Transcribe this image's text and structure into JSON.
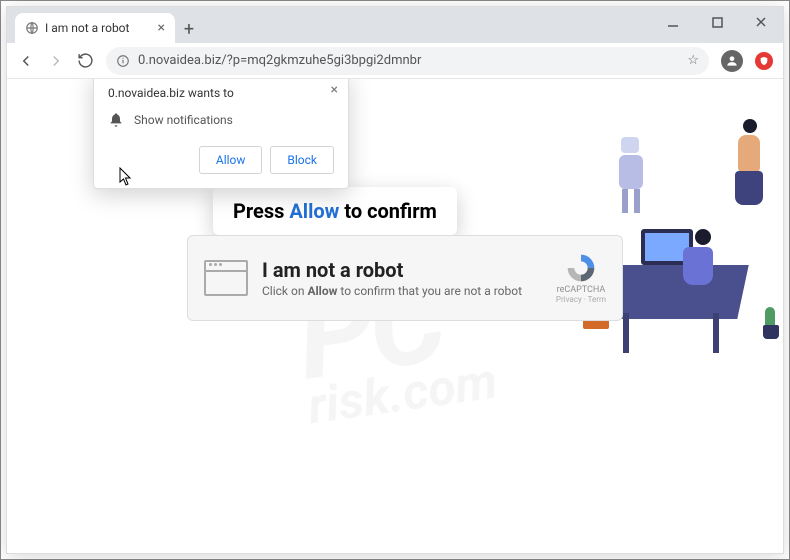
{
  "window": {
    "tab_title": "I am not a robot",
    "url": "0.novaidea.biz/?p=mq2gkmzuhe5gi3bpgi2dmnbr"
  },
  "notification": {
    "origin": "0.novaidea.biz wants to",
    "permission_label": "Show notifications",
    "allow_label": "Allow",
    "block_label": "Block"
  },
  "banner": {
    "press": "Press ",
    "allow": "Allow",
    "to_confirm": " to confirm"
  },
  "card": {
    "heading": "I am not a robot",
    "sub_prefix": "Click on ",
    "sub_bold": "Allow",
    "sub_suffix": " to confirm that you are not a robot",
    "recaptcha_label": "reCAPTCHA",
    "recaptcha_links": "Privacy · Term"
  },
  "watermark": {
    "big": "PC",
    "small": "risk.com"
  }
}
